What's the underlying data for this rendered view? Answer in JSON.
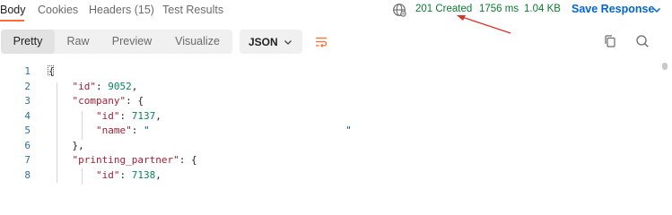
{
  "tabs": [
    {
      "label": "Body"
    },
    {
      "label": "Cookies"
    },
    {
      "label": "Headers (15)"
    },
    {
      "label": "Test Results"
    }
  ],
  "status": {
    "code": "201 Created",
    "time": "1756 ms",
    "size": "1.04 KB"
  },
  "save_response": "Save Response",
  "view_modes": [
    "Pretty",
    "Raw",
    "Preview",
    "Visualize"
  ],
  "active_view": "Pretty",
  "format": "JSON",
  "code_lines": [
    {
      "num": "1",
      "tokens": [
        {
          "t": "p",
          "v": "{"
        }
      ]
    },
    {
      "num": "2",
      "tokens": [
        {
          "t": "p",
          "v": "    "
        },
        {
          "t": "k",
          "v": "\"id\""
        },
        {
          "t": "p",
          "v": ": "
        },
        {
          "t": "n",
          "v": "9052"
        },
        {
          "t": "p",
          "v": ","
        }
      ]
    },
    {
      "num": "3",
      "tokens": [
        {
          "t": "p",
          "v": "    "
        },
        {
          "t": "k",
          "v": "\"company\""
        },
        {
          "t": "p",
          "v": ": {"
        }
      ]
    },
    {
      "num": "4",
      "tokens": [
        {
          "t": "p",
          "v": "        "
        },
        {
          "t": "k",
          "v": "\"id\""
        },
        {
          "t": "p",
          "v": ": "
        },
        {
          "t": "n",
          "v": "7137"
        },
        {
          "t": "p",
          "v": ","
        }
      ]
    },
    {
      "num": "5",
      "tokens": [
        {
          "t": "p",
          "v": "        "
        },
        {
          "t": "k",
          "v": "\"name\""
        },
        {
          "t": "p",
          "v": ": "
        },
        {
          "t": "s",
          "v": "\"                                 \""
        }
      ]
    },
    {
      "num": "6",
      "tokens": [
        {
          "t": "p",
          "v": "    },"
        }
      ]
    },
    {
      "num": "7",
      "tokens": [
        {
          "t": "p",
          "v": "    "
        },
        {
          "t": "k",
          "v": "\"printing_partner\""
        },
        {
          "t": "p",
          "v": ": {"
        }
      ]
    },
    {
      "num": "8",
      "tokens": [
        {
          "t": "p",
          "v": "        "
        },
        {
          "t": "k",
          "v": "\"id\""
        },
        {
          "t": "p",
          "v": ": "
        },
        {
          "t": "n",
          "v": "7138"
        },
        {
          "t": "p",
          "v": ","
        }
      ]
    }
  ],
  "icons": {
    "globe": "globe-icon",
    "chevron": "chevron-down-icon",
    "wrap": "wrap-lines-icon",
    "copy": "copy-icon",
    "search": "search-icon"
  },
  "colors": {
    "accent": "#ff6c37",
    "status_ok": "#0b7a33",
    "link": "#0265d2",
    "annotation_arrow": "#d9312b"
  }
}
